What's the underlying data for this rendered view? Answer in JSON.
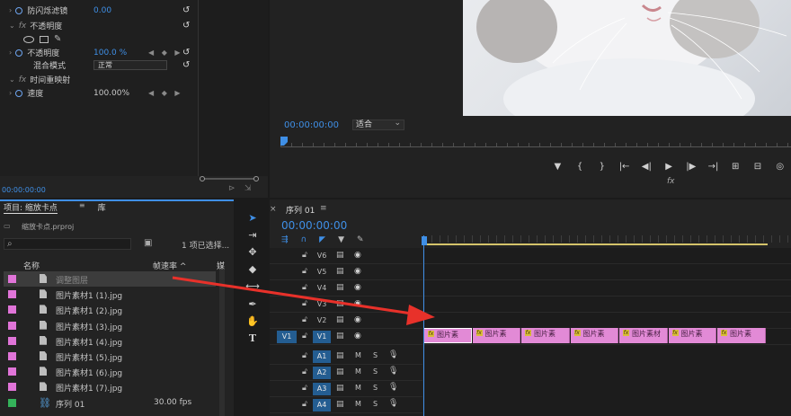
{
  "effect_controls": {
    "rows": [
      {
        "label": "防闪烁滤镜",
        "value": "0.00"
      },
      {
        "label": "不透明度",
        "section": true
      },
      {
        "label": "不透明度",
        "value": "100.0 %"
      },
      {
        "label": "混合模式",
        "value": "正常"
      },
      {
        "label": "时间重映射",
        "section": true
      },
      {
        "label": "速度",
        "value": "100.00%"
      }
    ],
    "timecode": "00:00:00:00"
  },
  "program": {
    "timecode": "00:00:00:00",
    "fit": "适合",
    "transport": [
      "▼",
      "{",
      "}",
      "|←",
      "◀|",
      "▶",
      "|▶",
      "→|",
      "⊞",
      "⊟",
      "◎"
    ],
    "fx": "fx"
  },
  "project": {
    "tabs": [
      "项目: 缩放卡点",
      "库"
    ],
    "path": "缩放卡点.prproj",
    "search_placeholder": "",
    "selection_count": "1 项已选择...",
    "columns": {
      "name": "名称",
      "fps": "帧速率 ^",
      "more": "媒"
    },
    "items": [
      {
        "name": "调整图层",
        "fps": "",
        "color": "#e074d8",
        "type": "file"
      },
      {
        "name": "图片素材1 (1).jpg",
        "fps": "",
        "color": "#e074d8",
        "type": "file"
      },
      {
        "name": "图片素材1 (2).jpg",
        "fps": "",
        "color": "#e074d8",
        "type": "file"
      },
      {
        "name": "图片素材1 (3).jpg",
        "fps": "",
        "color": "#e074d8",
        "type": "file"
      },
      {
        "name": "图片素材1 (4).jpg",
        "fps": "",
        "color": "#e074d8",
        "type": "file"
      },
      {
        "name": "图片素材1 (5).jpg",
        "fps": "",
        "color": "#e074d8",
        "type": "file"
      },
      {
        "name": "图片素材1 (6).jpg",
        "fps": "",
        "color": "#e074d8",
        "type": "file"
      },
      {
        "name": "图片素材1 (7).jpg",
        "fps": "",
        "color": "#e074d8",
        "type": "file"
      },
      {
        "name": "序列 01",
        "fps": "30.00 fps",
        "color": "#34b25a",
        "type": "sequence"
      }
    ]
  },
  "timeline": {
    "sequence_tab": "序列 01",
    "timecode": "00:00:00:00",
    "video_tracks": [
      "V6",
      "V5",
      "V4",
      "V3",
      "V2",
      "V1"
    ],
    "audio_tracks": [
      "A1",
      "A2",
      "A3",
      "A4"
    ],
    "source_video": "V1",
    "clips": [
      "图片素",
      "图片素",
      "图片素",
      "图片素",
      "图片素材",
      "图片素",
      "图片素"
    ]
  },
  "colors": {
    "accent": "#3f8fe6",
    "clip": "#e28ad6",
    "track_on": "#245d91"
  }
}
